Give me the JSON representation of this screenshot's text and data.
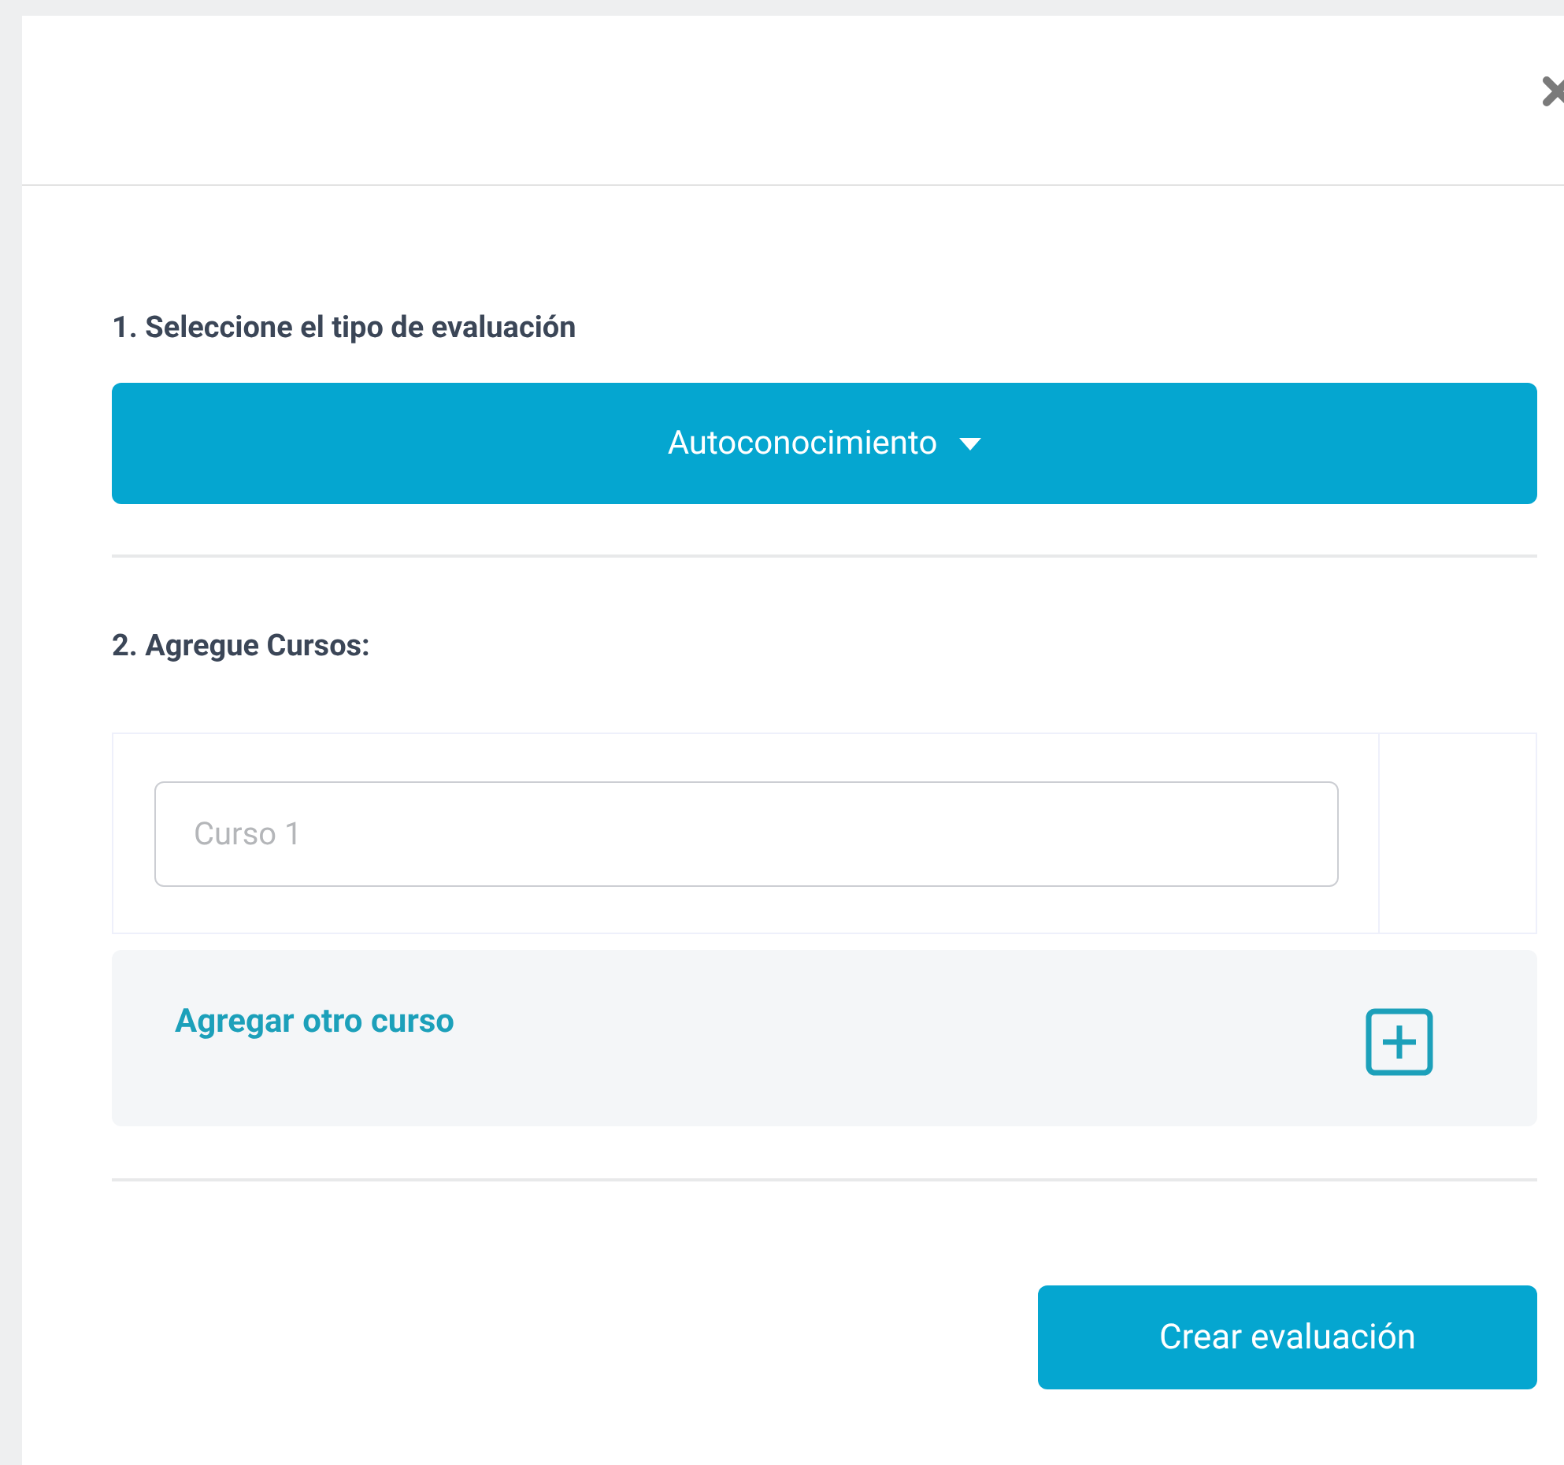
{
  "step_1": {
    "label": "1. Seleccione el tipo de evaluación",
    "dropdown": {
      "value": "Autoconocimiento"
    }
  },
  "step_2": {
    "label": "2. Agregue Cursos:",
    "courses": [
      {
        "placeholder": "Curso 1"
      }
    ],
    "add_course": {
      "label": "Agregar otro curso"
    }
  },
  "submit_button": "Crear evaluación"
}
